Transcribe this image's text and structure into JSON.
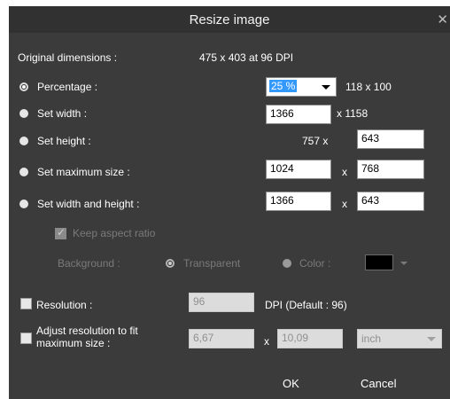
{
  "dialog": {
    "title": "Resize image"
  },
  "original": {
    "label": "Original dimensions :",
    "value": "475 x 403 at 96 DPI"
  },
  "percentage": {
    "label": "Percentage :",
    "value": "25 %",
    "result": "118 x 100"
  },
  "set_width": {
    "label": "Set width :",
    "value": "1366",
    "result": "x 1158"
  },
  "set_height": {
    "label": "Set height :",
    "result": "757 x",
    "value": "643"
  },
  "max_size": {
    "label": "Set maximum size :",
    "width": "1024",
    "x": "x",
    "height": "768"
  },
  "width_height": {
    "label": "Set width and height :",
    "width": "1366",
    "x": "x",
    "height": "643"
  },
  "keep_ratio": {
    "label": "Keep aspect ratio"
  },
  "background": {
    "label": "Background :",
    "transparent": "Transparent",
    "color": "Color :",
    "swatch_color": "#000000"
  },
  "resolution": {
    "label": "Resolution :",
    "value": "96",
    "suffix": "DPI (Default : 96)"
  },
  "adjust": {
    "label_line1": "Adjust resolution to fit",
    "label_line2": "maximum size :",
    "width": "6,67",
    "x": "x",
    "height": "10,09",
    "unit": "inch"
  },
  "buttons": {
    "ok": "OK",
    "cancel": "Cancel"
  }
}
